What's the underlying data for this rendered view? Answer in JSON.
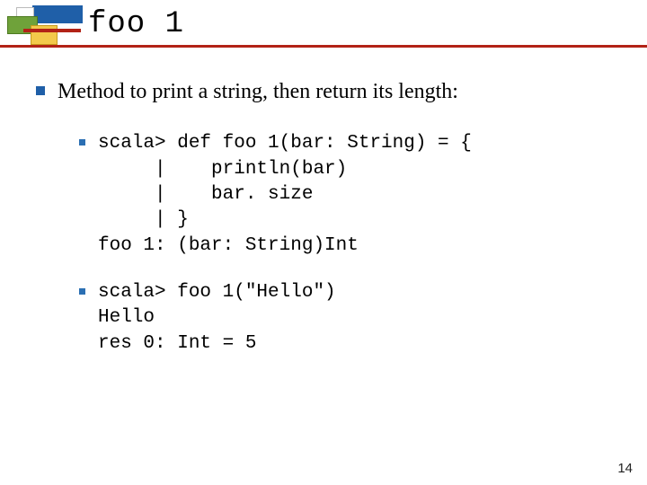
{
  "title": "foo 1",
  "lead": "Method to print a string, then return its length:",
  "code1": "scala> def foo 1(bar: String) = {\n     |    println(bar)\n     |    bar. size\n     | }\nfoo 1: (bar: String)Int",
  "code2": "scala> foo 1(\"Hello\")\nHello\nres 0: Int = 5",
  "page": "14"
}
